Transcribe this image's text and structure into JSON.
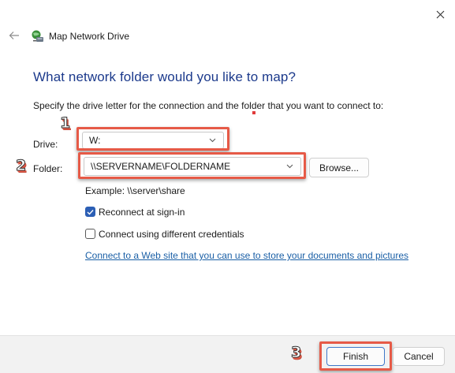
{
  "window": {
    "title": "Map Network Drive",
    "icons": {
      "back": "arrow-left-icon",
      "close": "close-icon",
      "app": "network-drive-icon"
    }
  },
  "main": {
    "heading": "What network folder would you like to map?",
    "instruction": "Specify the drive letter for the connection and the folder that you want to connect to:",
    "drive": {
      "label": "Drive:",
      "value": "W:"
    },
    "folder": {
      "label": "Folder:",
      "value": "\\\\SERVERNAME\\FOLDERNAME",
      "browse_label": "Browse..."
    },
    "example": "Example: \\\\server\\share",
    "reconnect": {
      "label": "Reconnect at sign-in",
      "checked": true
    },
    "credentials": {
      "label": "Connect using different credentials",
      "checked": false
    },
    "link": "Connect to a Web site that you can use to store your documents and pictures"
  },
  "footer": {
    "finish_label": "Finish",
    "cancel_label": "Cancel"
  },
  "annotations": {
    "step1": "1",
    "step2": "2",
    "step3": "3",
    "highlight_color": "#e65a47"
  },
  "colors": {
    "heading": "#1c3a8c",
    "link": "#1a5fa6",
    "checkbox": "#2c5fb5"
  }
}
